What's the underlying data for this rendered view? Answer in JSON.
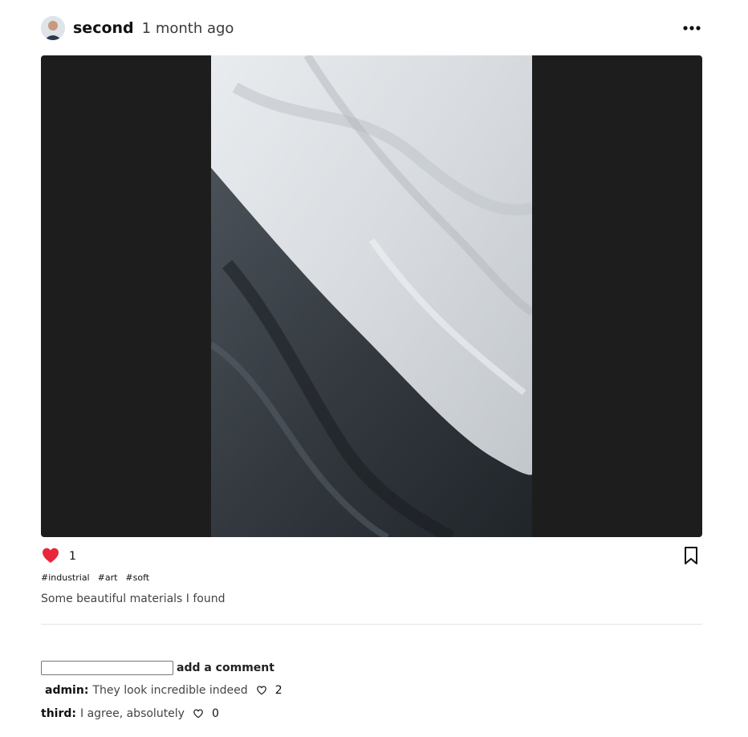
{
  "post": {
    "username": "second",
    "time_ago": "1 month ago",
    "like_count": "1",
    "liked": true,
    "tags": [
      "#industrial",
      "#art",
      "#soft"
    ],
    "caption": "Some beautiful materials I found"
  },
  "comment_form": {
    "input_value": "",
    "submit_label": "add a comment"
  },
  "comments": [
    {
      "author": "admin:",
      "text": "They look incredible indeed",
      "likes": "2"
    },
    {
      "author": "third:",
      "text": "I agree, absolutely",
      "likes": "0"
    }
  ],
  "icons": {
    "more": "more-horizontal-icon",
    "like": "heart-icon",
    "bookmark": "bookmark-icon",
    "comment_like": "heart-outline-icon"
  },
  "colors": {
    "like_active": "#e8263c",
    "media_background": "#1d1d1d"
  }
}
